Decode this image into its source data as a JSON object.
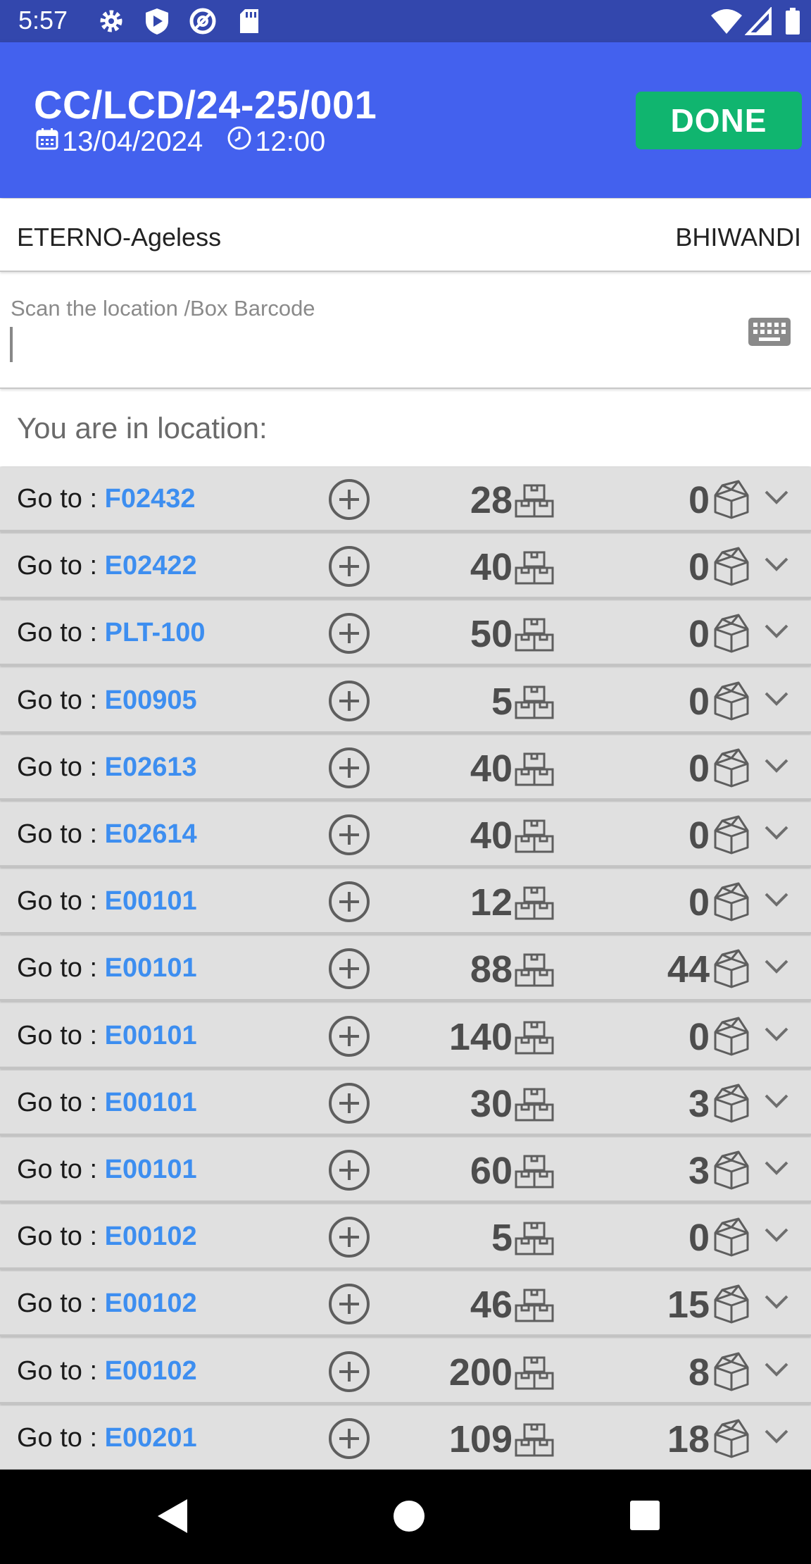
{
  "status_bar": {
    "time": "5:57"
  },
  "header": {
    "title": "CC/LCD/24-25/001",
    "date": "13/04/2024",
    "time": "12:00",
    "done_label": "DONE"
  },
  "info": {
    "client": "ETERNO-Ageless",
    "warehouse": "BHIWANDI"
  },
  "scan": {
    "label": "Scan the location /Box Barcode",
    "value": ""
  },
  "location": {
    "label": "You are in location:"
  },
  "goto_prefix": "Go to : ",
  "rows": [
    {
      "location": "F02432",
      "qty": "28",
      "scanned": "0"
    },
    {
      "location": "E02422",
      "qty": "40",
      "scanned": "0"
    },
    {
      "location": "PLT-100",
      "qty": "50",
      "scanned": "0"
    },
    {
      "location": "E00905",
      "qty": "5",
      "scanned": "0"
    },
    {
      "location": "E02613",
      "qty": "40",
      "scanned": "0"
    },
    {
      "location": "E02614",
      "qty": "40",
      "scanned": "0"
    },
    {
      "location": "E00101",
      "qty": "12",
      "scanned": "0"
    },
    {
      "location": "E00101",
      "qty": "88",
      "scanned": "44"
    },
    {
      "location": "E00101",
      "qty": "140",
      "scanned": "0"
    },
    {
      "location": "E00101",
      "qty": "30",
      "scanned": "3"
    },
    {
      "location": "E00101",
      "qty": "60",
      "scanned": "3"
    },
    {
      "location": "E00102",
      "qty": "5",
      "scanned": "0"
    },
    {
      "location": "E00102",
      "qty": "46",
      "scanned": "15"
    },
    {
      "location": "E00102",
      "qty": "200",
      "scanned": "8"
    },
    {
      "location": "E00201",
      "qty": "109",
      "scanned": "18"
    }
  ],
  "colors": {
    "status_bar": "#3347ad",
    "header": "#4361ee",
    "done_button": "#10b56f",
    "location_link": "#3d8ef0",
    "row_background": "#e0e0e0"
  },
  "icons": {
    "status": [
      "settings-icon",
      "play-protect-icon",
      "at-sign-icon",
      "sd-card-icon",
      "wifi-icon",
      "signal-icon",
      "battery-icon"
    ],
    "row": [
      "plus-circle-icon",
      "boxes-stack-icon",
      "open-box-icon",
      "chevron-down-icon"
    ],
    "nav": [
      "back-icon",
      "home-icon",
      "recents-icon"
    ]
  }
}
